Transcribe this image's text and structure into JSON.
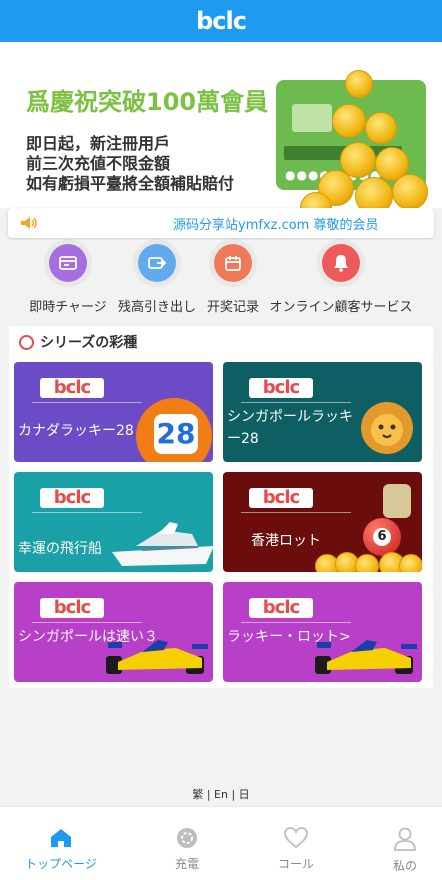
{
  "header": {
    "logo": "bclc"
  },
  "banner": {
    "title": "爲慶祝突破100萬會員",
    "lines": [
      "即日起，新注冊用戶",
      "前三次充値不限金額",
      "如有虧損平臺將全額補貼賠付"
    ]
  },
  "notice": {
    "text": "源码分享站ymfxz.com 尊敬的会员"
  },
  "quick_actions": [
    {
      "label": "即時チャージ",
      "icon": "wallet-icon",
      "color": "#a66ee0"
    },
    {
      "label": "残高引き出し",
      "icon": "transfer-icon",
      "color": "#63a9ee"
    },
    {
      "label": "开奖记录",
      "icon": "calendar-icon",
      "color": "#f0795a"
    },
    {
      "label": "オンライン顧客サービス",
      "icon": "bell-icon",
      "color": "#ee5a5a"
    }
  ],
  "section": {
    "title": "シリーズの彩種"
  },
  "games": [
    {
      "name": "カナダラッキー28",
      "color": "#6c4cc6",
      "art": "28"
    },
    {
      "name": "シンガポールラッキー28",
      "color": "#0e5f63",
      "art": "lion"
    },
    {
      "name": "幸運の飛行船",
      "color": "#1aa1a8",
      "art": "yacht"
    },
    {
      "name": "香港ロット",
      "color": "#6b0d0d",
      "art": "ball"
    },
    {
      "name": "シンガポールは速い３",
      "color": "#b83fc7",
      "art": "car"
    },
    {
      "name": "ラッキー・ロット>",
      "color": "#b83fc7",
      "art": "car"
    }
  ],
  "tile_logo": "bclc",
  "footer": {
    "languages": "繁 | En | 日"
  },
  "tabs": [
    {
      "label": "トップページ",
      "icon": "home-icon",
      "active": true
    },
    {
      "label": "充電",
      "icon": "charge-icon",
      "active": false
    },
    {
      "label": "コール",
      "icon": "heart-icon",
      "active": false
    },
    {
      "label": "私の",
      "icon": "user-icon",
      "active": false
    }
  ],
  "colors": {
    "primary": "#1e9bf0",
    "banner_title": "#7cc242",
    "section_marker": "#e94a4a"
  }
}
